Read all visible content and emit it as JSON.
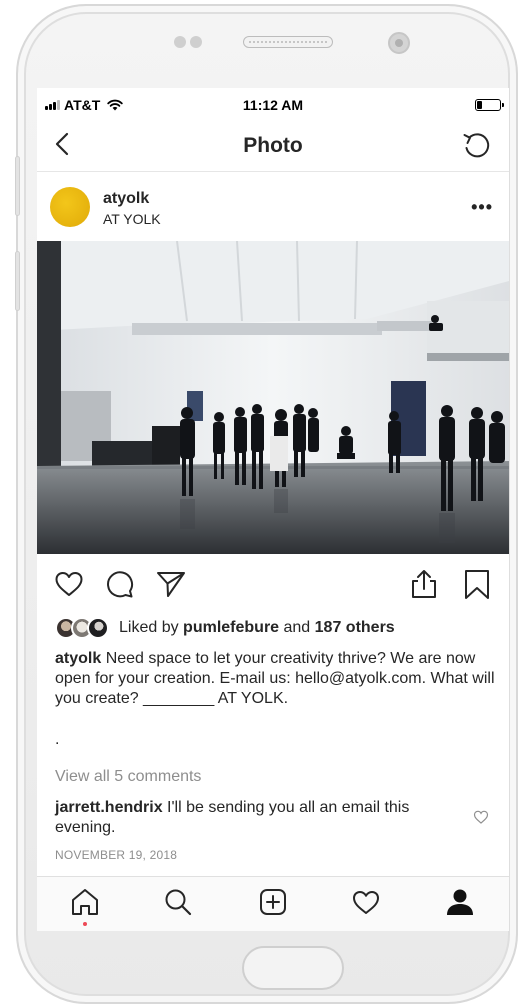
{
  "status_bar": {
    "carrier": "AT&T",
    "time": "11:12 AM"
  },
  "nav": {
    "title": "Photo"
  },
  "post": {
    "username": "atyolk",
    "location": "AT YOLK",
    "more_label": "•••",
    "likes": {
      "prefix": "Liked by ",
      "liker": "pumlefebure",
      "middle": " and ",
      "others": "187 others"
    },
    "caption": {
      "username": "atyolk",
      "text": "Need space to let your creativity thrive? We are now open for your creation. E-mail us: hello@atyolk.com. What will you create? ________ AT YOLK.",
      "trailing": "."
    },
    "view_comments": "View all 5 comments",
    "comment": {
      "username": "jarrett.hendrix",
      "text": "I'll be sending you all an email this evening."
    },
    "date": "NOVEMBER 19, 2018"
  },
  "colors": {
    "avatar": "#f0c419",
    "notification_dot": "#ed4956",
    "muted_text": "#8e8e8e",
    "text": "#262626"
  },
  "icons": {
    "nav": [
      "chevron-left-icon",
      "refresh-icon"
    ],
    "actions": [
      "heart-icon",
      "comment-icon",
      "send-icon",
      "share-icon",
      "bookmark-icon"
    ],
    "tabs": [
      "home-icon",
      "search-icon",
      "add-icon",
      "activity-heart-icon",
      "profile-icon"
    ]
  }
}
